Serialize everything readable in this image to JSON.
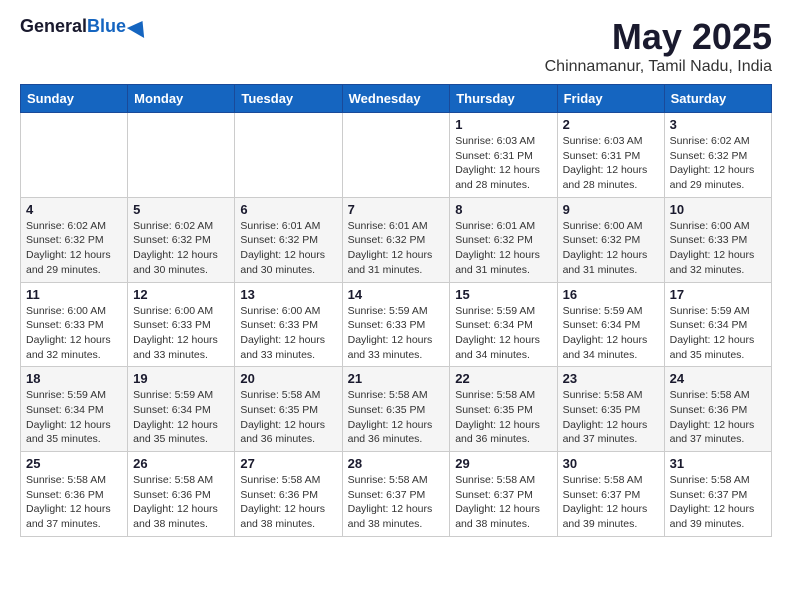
{
  "header": {
    "logo_general": "General",
    "logo_blue": "Blue",
    "month_title": "May 2025",
    "location": "Chinnamanur, Tamil Nadu, India"
  },
  "days_of_week": [
    "Sunday",
    "Monday",
    "Tuesday",
    "Wednesday",
    "Thursday",
    "Friday",
    "Saturday"
  ],
  "weeks": [
    [
      {
        "day": "",
        "info": ""
      },
      {
        "day": "",
        "info": ""
      },
      {
        "day": "",
        "info": ""
      },
      {
        "day": "",
        "info": ""
      },
      {
        "day": "1",
        "info": "Sunrise: 6:03 AM\nSunset: 6:31 PM\nDaylight: 12 hours and 28 minutes."
      },
      {
        "day": "2",
        "info": "Sunrise: 6:03 AM\nSunset: 6:31 PM\nDaylight: 12 hours and 28 minutes."
      },
      {
        "day": "3",
        "info": "Sunrise: 6:02 AM\nSunset: 6:32 PM\nDaylight: 12 hours and 29 minutes."
      }
    ],
    [
      {
        "day": "4",
        "info": "Sunrise: 6:02 AM\nSunset: 6:32 PM\nDaylight: 12 hours and 29 minutes."
      },
      {
        "day": "5",
        "info": "Sunrise: 6:02 AM\nSunset: 6:32 PM\nDaylight: 12 hours and 30 minutes."
      },
      {
        "day": "6",
        "info": "Sunrise: 6:01 AM\nSunset: 6:32 PM\nDaylight: 12 hours and 30 minutes."
      },
      {
        "day": "7",
        "info": "Sunrise: 6:01 AM\nSunset: 6:32 PM\nDaylight: 12 hours and 31 minutes."
      },
      {
        "day": "8",
        "info": "Sunrise: 6:01 AM\nSunset: 6:32 PM\nDaylight: 12 hours and 31 minutes."
      },
      {
        "day": "9",
        "info": "Sunrise: 6:00 AM\nSunset: 6:32 PM\nDaylight: 12 hours and 31 minutes."
      },
      {
        "day": "10",
        "info": "Sunrise: 6:00 AM\nSunset: 6:33 PM\nDaylight: 12 hours and 32 minutes."
      }
    ],
    [
      {
        "day": "11",
        "info": "Sunrise: 6:00 AM\nSunset: 6:33 PM\nDaylight: 12 hours and 32 minutes."
      },
      {
        "day": "12",
        "info": "Sunrise: 6:00 AM\nSunset: 6:33 PM\nDaylight: 12 hours and 33 minutes."
      },
      {
        "day": "13",
        "info": "Sunrise: 6:00 AM\nSunset: 6:33 PM\nDaylight: 12 hours and 33 minutes."
      },
      {
        "day": "14",
        "info": "Sunrise: 5:59 AM\nSunset: 6:33 PM\nDaylight: 12 hours and 33 minutes."
      },
      {
        "day": "15",
        "info": "Sunrise: 5:59 AM\nSunset: 6:34 PM\nDaylight: 12 hours and 34 minutes."
      },
      {
        "day": "16",
        "info": "Sunrise: 5:59 AM\nSunset: 6:34 PM\nDaylight: 12 hours and 34 minutes."
      },
      {
        "day": "17",
        "info": "Sunrise: 5:59 AM\nSunset: 6:34 PM\nDaylight: 12 hours and 35 minutes."
      }
    ],
    [
      {
        "day": "18",
        "info": "Sunrise: 5:59 AM\nSunset: 6:34 PM\nDaylight: 12 hours and 35 minutes."
      },
      {
        "day": "19",
        "info": "Sunrise: 5:59 AM\nSunset: 6:34 PM\nDaylight: 12 hours and 35 minutes."
      },
      {
        "day": "20",
        "info": "Sunrise: 5:58 AM\nSunset: 6:35 PM\nDaylight: 12 hours and 36 minutes."
      },
      {
        "day": "21",
        "info": "Sunrise: 5:58 AM\nSunset: 6:35 PM\nDaylight: 12 hours and 36 minutes."
      },
      {
        "day": "22",
        "info": "Sunrise: 5:58 AM\nSunset: 6:35 PM\nDaylight: 12 hours and 36 minutes."
      },
      {
        "day": "23",
        "info": "Sunrise: 5:58 AM\nSunset: 6:35 PM\nDaylight: 12 hours and 37 minutes."
      },
      {
        "day": "24",
        "info": "Sunrise: 5:58 AM\nSunset: 6:36 PM\nDaylight: 12 hours and 37 minutes."
      }
    ],
    [
      {
        "day": "25",
        "info": "Sunrise: 5:58 AM\nSunset: 6:36 PM\nDaylight: 12 hours and 37 minutes."
      },
      {
        "day": "26",
        "info": "Sunrise: 5:58 AM\nSunset: 6:36 PM\nDaylight: 12 hours and 38 minutes."
      },
      {
        "day": "27",
        "info": "Sunrise: 5:58 AM\nSunset: 6:36 PM\nDaylight: 12 hours and 38 minutes."
      },
      {
        "day": "28",
        "info": "Sunrise: 5:58 AM\nSunset: 6:37 PM\nDaylight: 12 hours and 38 minutes."
      },
      {
        "day": "29",
        "info": "Sunrise: 5:58 AM\nSunset: 6:37 PM\nDaylight: 12 hours and 38 minutes."
      },
      {
        "day": "30",
        "info": "Sunrise: 5:58 AM\nSunset: 6:37 PM\nDaylight: 12 hours and 39 minutes."
      },
      {
        "day": "31",
        "info": "Sunrise: 5:58 AM\nSunset: 6:37 PM\nDaylight: 12 hours and 39 minutes."
      }
    ]
  ]
}
